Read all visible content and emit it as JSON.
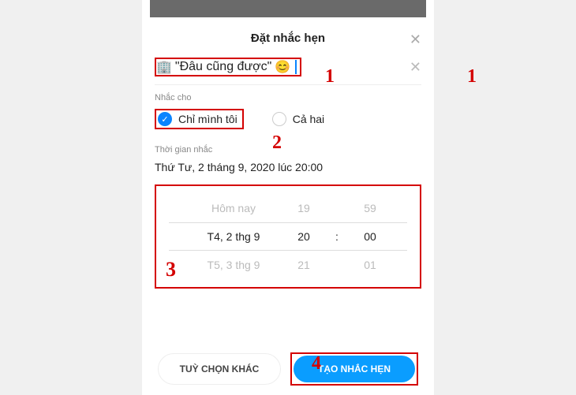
{
  "modal": {
    "title": "Đặt nhắc hẹn",
    "close": "✕"
  },
  "reminder_title": {
    "icon": "🏢",
    "text": "\"Đâu cũng được\"",
    "emoji": "😊",
    "clear": "✕"
  },
  "remind_for": {
    "label": "Nhắc cho",
    "only_me": "Chỉ mình tôi",
    "both": "Cả hai"
  },
  "remind_time": {
    "label": "Thời gian nhắc",
    "value": "Thứ Tư, 2 tháng 9, 2020 lúc 20:00"
  },
  "picker": {
    "rows": [
      {
        "date": "Hôm nay",
        "hour": "19",
        "min": "59"
      },
      {
        "date": "T4, 2 thg 9",
        "hour": "20",
        "min": "00"
      },
      {
        "date": "T5, 3 thg 9",
        "hour": "21",
        "min": "01"
      }
    ],
    "colon": ":"
  },
  "footer": {
    "secondary": "TUỲ CHỌN KHÁC",
    "primary": "TẠO NHẮC HẸN"
  },
  "annotations": {
    "a1": "1",
    "a2": "2",
    "a3": "3",
    "a4": "4"
  }
}
